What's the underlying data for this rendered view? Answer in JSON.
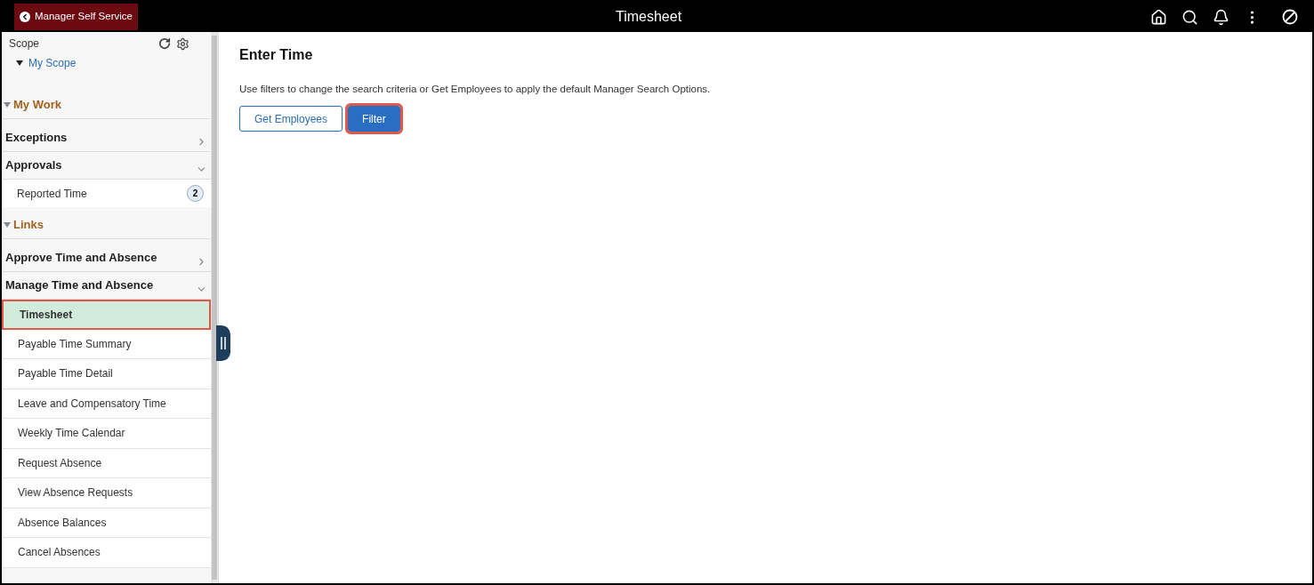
{
  "header": {
    "back_button": "Manager Self Service",
    "title": "Timesheet"
  },
  "sidebar": {
    "scope": {
      "label": "Scope",
      "link": "My Scope",
      "expanded": true
    },
    "sections": [
      {
        "title": "My Work",
        "expanded": true,
        "items": [
          {
            "kind": "group",
            "label": "Exceptions",
            "expanded": false
          },
          {
            "kind": "group",
            "label": "Approvals",
            "expanded": true
          },
          {
            "kind": "sub",
            "label": "Reported Time",
            "badge": "2",
            "selected": false
          }
        ]
      },
      {
        "title": "Links",
        "expanded": true,
        "items": [
          {
            "kind": "group",
            "label": "Approve Time and Absence",
            "expanded": false
          },
          {
            "kind": "group",
            "label": "Manage Time and Absence",
            "expanded": true
          },
          {
            "kind": "link",
            "label": "Timesheet",
            "selected": true
          },
          {
            "kind": "link",
            "label": "Payable Time Summary",
            "selected": false
          },
          {
            "kind": "link",
            "label": "Payable Time Detail",
            "selected": false
          },
          {
            "kind": "link",
            "label": "Leave and Compensatory Time",
            "selected": false
          },
          {
            "kind": "link",
            "label": "Weekly Time Calendar",
            "selected": false
          },
          {
            "kind": "link",
            "label": "Request Absence",
            "selected": false
          },
          {
            "kind": "link",
            "label": "View Absence Requests",
            "selected": false
          },
          {
            "kind": "link",
            "label": "Absence Balances",
            "selected": false
          },
          {
            "kind": "link",
            "label": "Cancel Absences",
            "selected": false
          }
        ]
      }
    ]
  },
  "main": {
    "title": "Enter Time",
    "instructions": "Use filters to change the search criteria or Get Employees to apply the default Manager Search Options.",
    "buttons": [
      {
        "label": "Get Employees",
        "kind": "secondary",
        "highlighted": false
      },
      {
        "label": "Filter",
        "kind": "primary",
        "highlighted": true
      }
    ]
  }
}
